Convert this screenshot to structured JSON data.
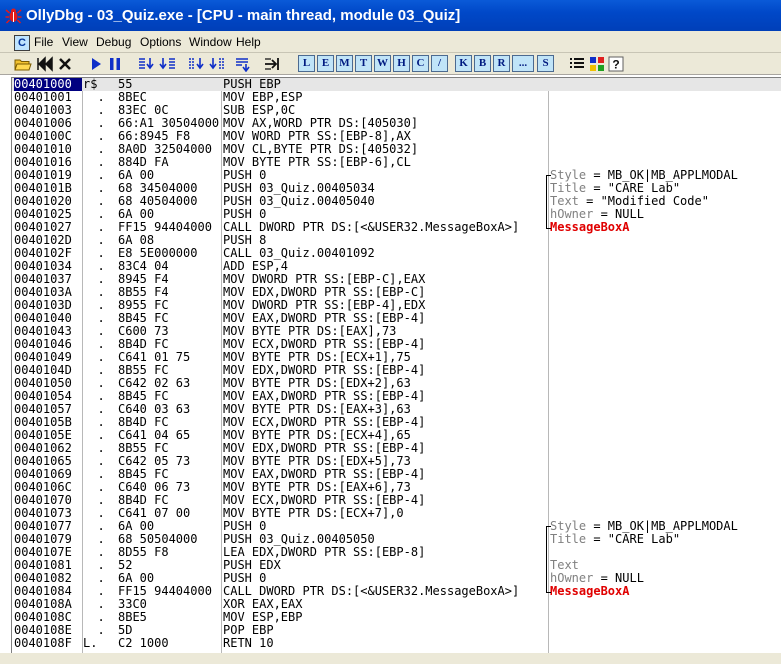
{
  "window": {
    "title": "OllyDbg - 03_Quiz.exe - [CPU - main thread, module 03_Quiz]",
    "title_color": "#0048c8"
  },
  "menubar": {
    "cpu_icon_label": "C",
    "items": [
      "File",
      "View",
      "Debug",
      "Options",
      "Window",
      "Help"
    ]
  },
  "toolbar": {
    "icons": [
      "open-icon",
      "restart-icon",
      "close-icon",
      "run-icon",
      "pause-icon",
      "step-into-icon",
      "step-over-icon",
      "trace-into-icon",
      "trace-over-icon",
      "execute-till-return-icon",
      "go-to-address-icon"
    ],
    "letter_buttons": [
      "L",
      "E",
      "M",
      "T",
      "W",
      "H",
      "C",
      "/",
      "K",
      "B",
      "R",
      "...",
      "S"
    ],
    "right_icons": [
      "list-icon",
      "color-grid-icon",
      "help-icon"
    ]
  },
  "disassembly": {
    "rows": [
      {
        "addr": "00401000",
        "br": "r$",
        "hex": "55",
        "asm": "PUSH EBP"
      },
      {
        "addr": "00401001",
        "br": "  .",
        "hex": "8BEC",
        "asm": "MOV EBP,ESP"
      },
      {
        "addr": "00401003",
        "br": "  .",
        "hex": "83EC 0C",
        "asm": "SUB ESP,0C"
      },
      {
        "addr": "00401006",
        "br": "  .",
        "hex": "66:A1 30504000",
        "asm": "MOV AX,WORD PTR DS:[405030]"
      },
      {
        "addr": "0040100C",
        "br": "  .",
        "hex": "66:8945 F8",
        "asm": "MOV WORD PTR SS:[EBP-8],AX"
      },
      {
        "addr": "00401010",
        "br": "  .",
        "hex": "8A0D 32504000",
        "asm": "MOV CL,BYTE PTR DS:[405032]"
      },
      {
        "addr": "00401016",
        "br": "  .",
        "hex": "884D FA",
        "asm": "MOV BYTE PTR SS:[EBP-6],CL"
      },
      {
        "addr": "00401019",
        "br": "  .",
        "hex": "6A 00",
        "asm": "PUSH 0",
        "cmt": "Style = MB_OK|MB_APPLMODAL"
      },
      {
        "addr": "0040101B",
        "br": "  .",
        "hex": "68 34504000",
        "asm": "PUSH 03_Quiz.00405034",
        "cmt": "Title = \"CARE Lab\""
      },
      {
        "addr": "00401020",
        "br": "  .",
        "hex": "68 40504000",
        "asm": "PUSH 03_Quiz.00405040",
        "cmt": "Text = \"Modified Code\""
      },
      {
        "addr": "00401025",
        "br": "  .",
        "hex": "6A 00",
        "asm": "PUSH 0",
        "cmt": "hOwner = NULL"
      },
      {
        "addr": "00401027",
        "br": "  .",
        "hex": "FF15 94404000",
        "asm": "CALL DWORD PTR DS:[<&USER32.MessageBoxA>]",
        "cmt": "MessageBoxA"
      },
      {
        "addr": "0040102D",
        "br": "  .",
        "hex": "6A 08",
        "asm": "PUSH 8"
      },
      {
        "addr": "0040102F",
        "br": "  .",
        "hex": "E8 5E000000",
        "asm": "CALL 03_Quiz.00401092"
      },
      {
        "addr": "00401034",
        "br": "  .",
        "hex": "83C4 04",
        "asm": "ADD ESP,4"
      },
      {
        "addr": "00401037",
        "br": "  .",
        "hex": "8945 F4",
        "asm": "MOV DWORD PTR SS:[EBP-C],EAX"
      },
      {
        "addr": "0040103A",
        "br": "  .",
        "hex": "8B55 F4",
        "asm": "MOV EDX,DWORD PTR SS:[EBP-C]"
      },
      {
        "addr": "0040103D",
        "br": "  .",
        "hex": "8955 FC",
        "asm": "MOV DWORD PTR SS:[EBP-4],EDX"
      },
      {
        "addr": "00401040",
        "br": "  .",
        "hex": "8B45 FC",
        "asm": "MOV EAX,DWORD PTR SS:[EBP-4]"
      },
      {
        "addr": "00401043",
        "br": "  .",
        "hex": "C600 73",
        "asm": "MOV BYTE PTR DS:[EAX],73"
      },
      {
        "addr": "00401046",
        "br": "  .",
        "hex": "8B4D FC",
        "asm": "MOV ECX,DWORD PTR SS:[EBP-4]"
      },
      {
        "addr": "00401049",
        "br": "  .",
        "hex": "C641 01 75",
        "asm": "MOV BYTE PTR DS:[ECX+1],75"
      },
      {
        "addr": "0040104D",
        "br": "  .",
        "hex": "8B55 FC",
        "asm": "MOV EDX,DWORD PTR SS:[EBP-4]"
      },
      {
        "addr": "00401050",
        "br": "  .",
        "hex": "C642 02 63",
        "asm": "MOV BYTE PTR DS:[EDX+2],63"
      },
      {
        "addr": "00401054",
        "br": "  .",
        "hex": "8B45 FC",
        "asm": "MOV EAX,DWORD PTR SS:[EBP-4]"
      },
      {
        "addr": "00401057",
        "br": "  .",
        "hex": "C640 03 63",
        "asm": "MOV BYTE PTR DS:[EAX+3],63"
      },
      {
        "addr": "0040105B",
        "br": "  .",
        "hex": "8B4D FC",
        "asm": "MOV ECX,DWORD PTR SS:[EBP-4]"
      },
      {
        "addr": "0040105E",
        "br": "  .",
        "hex": "C641 04 65",
        "asm": "MOV BYTE PTR DS:[ECX+4],65"
      },
      {
        "addr": "00401062",
        "br": "  .",
        "hex": "8B55 FC",
        "asm": "MOV EDX,DWORD PTR SS:[EBP-4]"
      },
      {
        "addr": "00401065",
        "br": "  .",
        "hex": "C642 05 73",
        "asm": "MOV BYTE PTR DS:[EDX+5],73"
      },
      {
        "addr": "00401069",
        "br": "  .",
        "hex": "8B45 FC",
        "asm": "MOV EAX,DWORD PTR SS:[EBP-4]"
      },
      {
        "addr": "0040106C",
        "br": "  .",
        "hex": "C640 06 73",
        "asm": "MOV BYTE PTR DS:[EAX+6],73"
      },
      {
        "addr": "00401070",
        "br": "  .",
        "hex": "8B4D FC",
        "asm": "MOV ECX,DWORD PTR SS:[EBP-4]"
      },
      {
        "addr": "00401073",
        "br": "  .",
        "hex": "C641 07 00",
        "asm": "MOV BYTE PTR DS:[ECX+7],0"
      },
      {
        "addr": "00401077",
        "br": "  .",
        "hex": "6A 00",
        "asm": "PUSH 0",
        "cmt": "Style = MB_OK|MB_APPLMODAL"
      },
      {
        "addr": "00401079",
        "br": "  .",
        "hex": "68 50504000",
        "asm": "PUSH 03_Quiz.00405050",
        "cmt": "Title = \"CARE Lab\""
      },
      {
        "addr": "0040107E",
        "br": "  .",
        "hex": "8D55 F8",
        "asm": "LEA EDX,DWORD PTR SS:[EBP-8]"
      },
      {
        "addr": "00401081",
        "br": "  .",
        "hex": "52",
        "asm": "PUSH EDX",
        "cmt": "Text"
      },
      {
        "addr": "00401082",
        "br": "  .",
        "hex": "6A 00",
        "asm": "PUSH 0",
        "cmt": "hOwner = NULL"
      },
      {
        "addr": "00401084",
        "br": "  .",
        "hex": "FF15 94404000",
        "asm": "CALL DWORD PTR DS:[<&USER32.MessageBoxA>]",
        "cmt": "MessageBoxA"
      },
      {
        "addr": "0040108A",
        "br": "  .",
        "hex": "33C0",
        "asm": "XOR EAX,EAX"
      },
      {
        "addr": "0040108C",
        "br": "  .",
        "hex": "8BE5",
        "asm": "MOV ESP,EBP"
      },
      {
        "addr": "0040108E",
        "br": "  .",
        "hex": "5D",
        "asm": "POP EBP"
      },
      {
        "addr": "0040108F",
        "br": "L.",
        "hex": "C2 1000",
        "asm": "RETN 10"
      }
    ],
    "selected_row": 0,
    "comment_label_color": "#808080",
    "api_color": "#e00000"
  }
}
